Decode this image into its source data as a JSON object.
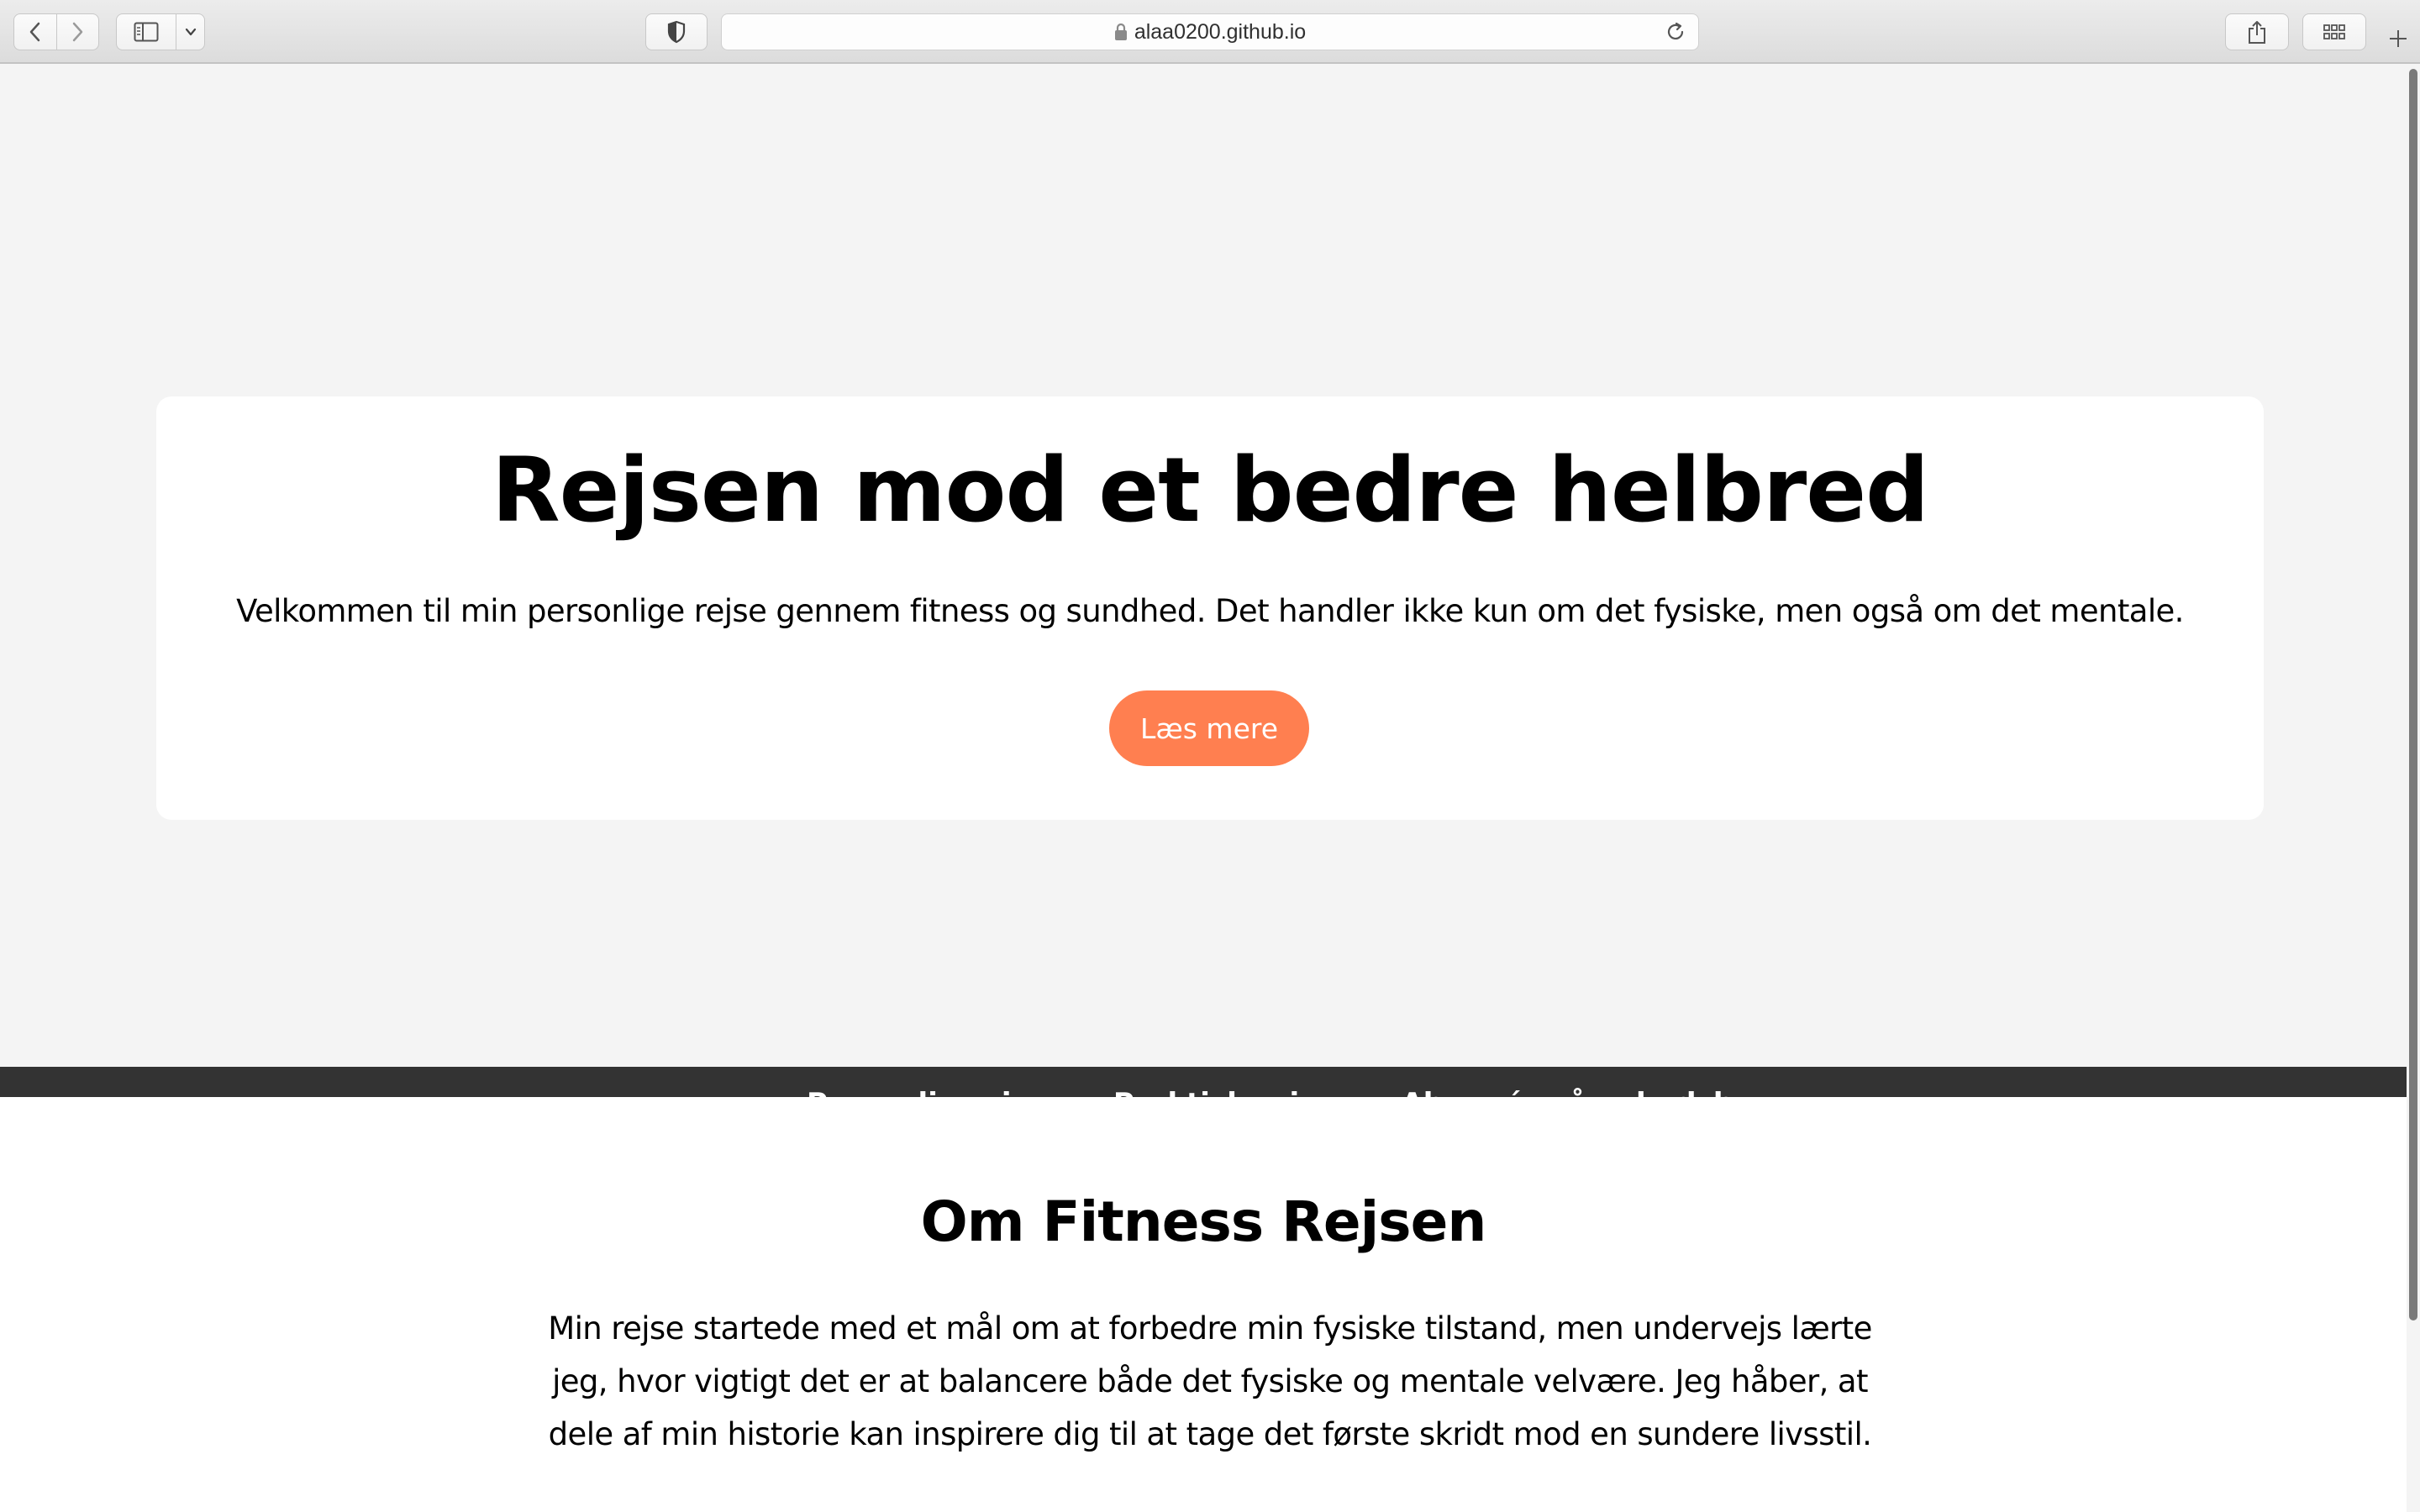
{
  "browser": {
    "url": "alaa0200.github.io",
    "icons": {
      "back": "chevron-left-icon",
      "forward": "chevron-right-icon",
      "sidebar": "sidebar-icon",
      "sidebar_menu": "chevron-down-icon",
      "privacy": "shield-icon",
      "secure": "lock-icon",
      "reload": "reload-icon",
      "share": "share-icon",
      "tabs": "tab-overview-icon",
      "new_tab": "plus-icon"
    }
  },
  "hero": {
    "title": "Rejsen mod et bedre helbred",
    "subtitle": "Velkommen til min personlige rejse gennem fitness og sundhed. Det handler ikke kun om det fysiske, men også om det mentale.",
    "button_label": "Læs mere",
    "button_color": "#ff7f50"
  },
  "nav": {
    "links": [
      "Personlig rejse",
      "Praktisk rejse",
      "Abonnér på nyhedsbrev"
    ]
  },
  "about": {
    "title": "Om Fitness Rejsen",
    "text": "Min rejse startede med et mål om at forbedre min fysiske tilstand, men undervejs lærte jeg, hvor vigtigt det er at balancere både det fysiske og mentale velvære. Jeg håber, at dele af min historie kan inspirere dig til at tage det første skridt mod en sundere livsstil."
  },
  "colors": {
    "page_background": "#f4f4f4",
    "card_background": "#ffffff",
    "nav_background": "#333333",
    "accent": "#ff7f50"
  }
}
